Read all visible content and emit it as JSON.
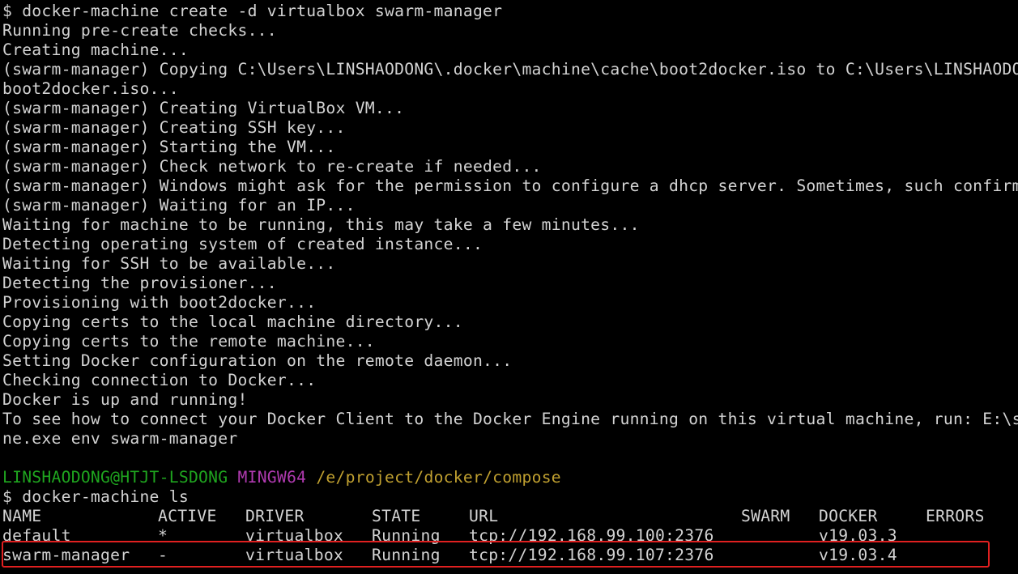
{
  "terminal": {
    "lines": [
      "$ docker-machine create -d virtualbox swarm-manager",
      "Running pre-create checks...",
      "Creating machine...",
      "(swarm-manager) Copying C:\\Users\\LINSHAODONG\\.docker\\machine\\cache\\boot2docker.iso to C:\\Users\\LINSHAODON",
      "boot2docker.iso...",
      "(swarm-manager) Creating VirtualBox VM...",
      "(swarm-manager) Creating SSH key...",
      "(swarm-manager) Starting the VM...",
      "(swarm-manager) Check network to re-create if needed...",
      "(swarm-manager) Windows might ask for the permission to configure a dhcp server. Sometimes, such confirma",
      "(swarm-manager) Waiting for an IP...",
      "Waiting for machine to be running, this may take a few minutes...",
      "Detecting operating system of created instance...",
      "Waiting for SSH to be available...",
      "Detecting the provisioner...",
      "Provisioning with boot2docker...",
      "Copying certs to the local machine directory...",
      "Copying certs to the remote machine...",
      "Setting Docker configuration on the remote daemon...",
      "Checking connection to Docker...",
      "Docker is up and running!",
      "To see how to connect your Docker Client to the Docker Engine running on this virtual machine, run: E:\\so",
      "ne.exe env swarm-manager",
      ""
    ],
    "prompt": {
      "user_host": "LINSHAODONG@HTJT-LSDONG",
      "system": "MINGW64",
      "path": "/e/project/docker/compose"
    },
    "command2": "$ docker-machine ls",
    "table": {
      "headers": {
        "name": "NAME",
        "active": "ACTIVE",
        "driver": "DRIVER",
        "state": "STATE",
        "url": "URL",
        "swarm": "SWARM",
        "docker": "DOCKER",
        "errors": "ERRORS"
      },
      "rows": [
        {
          "name": "default",
          "active": "*",
          "driver": "virtualbox",
          "state": "Running",
          "url": "tcp://192.168.99.100:2376",
          "swarm": "",
          "docker": "v19.03.3",
          "errors": ""
        },
        {
          "name": "swarm-manager",
          "active": "-",
          "driver": "virtualbox",
          "state": "Running",
          "url": "tcp://192.168.99.107:2376",
          "swarm": "",
          "docker": "v19.03.4",
          "errors": ""
        }
      ]
    },
    "colors": {
      "background": "#000000",
      "text": "#d3d3d3",
      "prompt_user": "#1fa51f",
      "prompt_system": "#b03ab0",
      "prompt_path": "#c0a030",
      "highlight": "#e02020"
    }
  }
}
